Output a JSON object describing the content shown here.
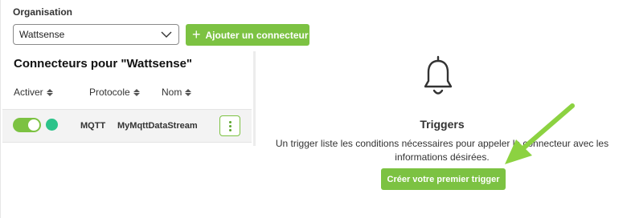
{
  "organisation": {
    "label": "Organisation",
    "selected": "Wattsense",
    "add_button_label": "Ajouter un connecteur"
  },
  "connectors": {
    "title": "Connecteurs pour \"Wattsense\"",
    "columns": [
      "Activer",
      "Protocole",
      "Nom"
    ],
    "rows": [
      {
        "enabled": true,
        "status": "online",
        "protocol": "MQTT",
        "name": "MyMqttDataStream"
      }
    ]
  },
  "triggers": {
    "icon": "bell-icon",
    "title": "Triggers",
    "description": "Un trigger liste les conditions nécessaires pour appeler le connecteur avec les informations désirées.",
    "cta_label": "Créer votre premier trigger"
  },
  "colors": {
    "accent": "#7cc242",
    "status_online": "#2cc38a",
    "annotation_arrow": "#8cd241"
  }
}
